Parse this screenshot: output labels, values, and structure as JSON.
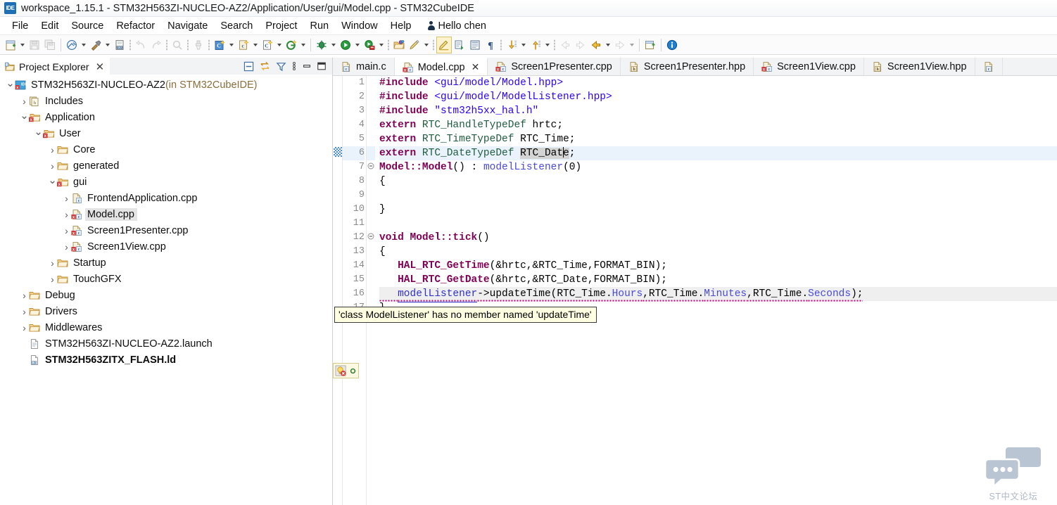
{
  "window": {
    "icon": "ide-icon",
    "title": "workspace_1.15.1 - STM32H563ZI-NUCLEO-AZ2/Application/User/gui/Model.cpp - STM32CubeIDE"
  },
  "menu": {
    "items": [
      "File",
      "Edit",
      "Source",
      "Refactor",
      "Navigate",
      "Search",
      "Project",
      "Run",
      "Window",
      "Help"
    ],
    "user": "Hello chen",
    "user_icon": "person-icon"
  },
  "toolbar": {
    "groups": [
      {
        "items": [
          {
            "name": "new-icon",
            "kind": "new",
            "dropdown": true
          },
          {
            "name": "save-icon",
            "kind": "save",
            "dropdown": false,
            "disabled": true
          },
          {
            "name": "save-all-icon",
            "kind": "saveall",
            "dropdown": false,
            "disabled": true
          }
        ]
      },
      {
        "items": [
          {
            "name": "build-all-icon",
            "kind": "buildall",
            "dropdown": true
          },
          {
            "name": "build-hammer-icon",
            "kind": "hammer",
            "dropdown": true
          },
          {
            "name": "build-binary-icon",
            "kind": "binary",
            "dropdown": false
          }
        ]
      },
      {
        "items": [
          {
            "name": "undo-icon",
            "kind": "undo",
            "dropdown": false,
            "disabled": true
          },
          {
            "name": "redo-icon",
            "kind": "redo",
            "dropdown": false,
            "disabled": true
          }
        ]
      },
      {
        "items": [
          {
            "name": "terminate-icon",
            "kind": "terminate",
            "dropdown": false,
            "disabled": true
          }
        ]
      },
      {
        "items": [
          {
            "name": "clean-icon",
            "kind": "clean",
            "dropdown": false,
            "disabled": true
          }
        ]
      },
      {
        "items": [
          {
            "name": "new-c-cpp-project-icon",
            "kind": "cproj",
            "dropdown": true
          },
          {
            "name": "new-c-file-icon",
            "kind": "cfile",
            "dropdown": true
          },
          {
            "name": "new-c-class-icon",
            "kind": "cclass",
            "dropdown": true
          },
          {
            "name": "git-icon",
            "kind": "git",
            "dropdown": true
          }
        ]
      },
      {
        "items": [
          {
            "name": "debug-icon",
            "kind": "debug",
            "dropdown": true
          },
          {
            "name": "run-icon",
            "kind": "run",
            "dropdown": true
          },
          {
            "name": "run-configuration-icon",
            "kind": "runcfg",
            "dropdown": true
          }
        ]
      },
      {
        "items": [
          {
            "name": "open-perspective-icon",
            "kind": "openpersp",
            "dropdown": false
          },
          {
            "name": "highlight-pencil-icon",
            "kind": "pencil",
            "dropdown": true
          }
        ]
      },
      {
        "items": [
          {
            "name": "toggle-mark-occurrences-icon",
            "kind": "markocc",
            "dropdown": false,
            "pressed": true
          },
          {
            "name": "show-whitespace-icon",
            "kind": "whitespace",
            "dropdown": false
          },
          {
            "name": "show-source-quick-icon",
            "kind": "srcquick",
            "dropdown": false
          },
          {
            "name": "pilcrow-icon",
            "kind": "pilcrow",
            "dropdown": false
          }
        ]
      },
      {
        "items": [
          {
            "name": "next-annotation-icon",
            "kind": "nextannot",
            "dropdown": true
          },
          {
            "name": "previous-annotation-icon",
            "kind": "prevannot",
            "dropdown": true
          }
        ]
      },
      {
        "items": [
          {
            "name": "back-disabled-icon",
            "kind": "backdis",
            "dropdown": false,
            "disabled": true
          },
          {
            "name": "forward-disabled-icon",
            "kind": "fwddis",
            "dropdown": false,
            "disabled": true
          },
          {
            "name": "back-icon",
            "kind": "back",
            "dropdown": true
          },
          {
            "name": "forward-icon",
            "kind": "forward",
            "dropdown": true,
            "disabled": true
          }
        ]
      },
      {
        "items": [
          {
            "name": "new-window-icon",
            "kind": "newwin",
            "dropdown": false
          }
        ]
      },
      {
        "items": [
          {
            "name": "info-icon",
            "kind": "info",
            "dropdown": false
          }
        ]
      }
    ]
  },
  "explorer": {
    "title": "Project Explorer",
    "close_label": "✕",
    "tools": [
      {
        "name": "collapse-all-icon",
        "label": "collapse-all"
      },
      {
        "name": "link-with-editor-icon",
        "label": "link-with-editor"
      },
      {
        "name": "filter-icon",
        "label": "filters"
      },
      {
        "name": "view-menu-icon",
        "label": "view-menu"
      },
      {
        "name": "minimize-icon",
        "label": "minimize"
      },
      {
        "name": "maximize-icon",
        "label": "maximize"
      }
    ],
    "tree": [
      {
        "indent": 0,
        "twist": "v",
        "icon": "project-icon",
        "label": "STM32H563ZI-NUCLEO-AZ2",
        "suffix": " (in STM32CubeIDE)",
        "bold": false,
        "selected": false
      },
      {
        "indent": 1,
        "twist": ">",
        "icon": "includes-icon",
        "label": "Includes",
        "suffix": "",
        "bold": false,
        "selected": false
      },
      {
        "indent": 1,
        "twist": "v",
        "icon": "src-folder-error-icon",
        "label": "Application",
        "suffix": "",
        "bold": false,
        "selected": false
      },
      {
        "indent": 2,
        "twist": "v",
        "icon": "src-folder-error-icon",
        "label": "User",
        "suffix": "",
        "bold": false,
        "selected": false
      },
      {
        "indent": 3,
        "twist": ">",
        "icon": "folder-icon",
        "label": "Core",
        "suffix": "",
        "bold": false,
        "selected": false
      },
      {
        "indent": 3,
        "twist": ">",
        "icon": "folder-icon",
        "label": "generated",
        "suffix": "",
        "bold": false,
        "selected": false
      },
      {
        "indent": 3,
        "twist": "v",
        "icon": "src-folder-error-icon",
        "label": "gui",
        "suffix": "",
        "bold": false,
        "selected": false
      },
      {
        "indent": 4,
        "twist": ">",
        "icon": "cpp-file-icon",
        "label": "FrontendApplication.cpp",
        "suffix": "",
        "bold": false,
        "selected": false
      },
      {
        "indent": 4,
        "twist": ">",
        "icon": "cpp-file-error-icon",
        "label": "Model.cpp",
        "suffix": "",
        "bold": false,
        "selected": true
      },
      {
        "indent": 4,
        "twist": ">",
        "icon": "cpp-file-error-icon",
        "label": "Screen1Presenter.cpp",
        "suffix": "",
        "bold": false,
        "selected": false
      },
      {
        "indent": 4,
        "twist": ">",
        "icon": "cpp-file-error-icon",
        "label": "Screen1View.cpp",
        "suffix": "",
        "bold": false,
        "selected": false
      },
      {
        "indent": 3,
        "twist": ">",
        "icon": "folder-icon",
        "label": "Startup",
        "suffix": "",
        "bold": false,
        "selected": false
      },
      {
        "indent": 3,
        "twist": ">",
        "icon": "folder-icon",
        "label": "TouchGFX",
        "suffix": "",
        "bold": false,
        "selected": false
      },
      {
        "indent": 1,
        "twist": ">",
        "icon": "folder-icon",
        "label": "Debug",
        "suffix": "",
        "bold": false,
        "selected": false
      },
      {
        "indent": 1,
        "twist": ">",
        "icon": "folder-icon",
        "label": "Drivers",
        "suffix": "",
        "bold": false,
        "selected": false
      },
      {
        "indent": 1,
        "twist": ">",
        "icon": "folder-icon",
        "label": "Middlewares",
        "suffix": "",
        "bold": false,
        "selected": false
      },
      {
        "indent": 1,
        "twist": "",
        "icon": "launch-file-icon",
        "label": "STM32H563ZI-NUCLEO-AZ2.launch",
        "suffix": "",
        "bold": false,
        "selected": false
      },
      {
        "indent": 1,
        "twist": "",
        "icon": "ld-file-icon",
        "label": "STM32H563ZITX_FLASH.ld",
        "suffix": "",
        "bold": true,
        "selected": false
      }
    ]
  },
  "editor": {
    "tabs": [
      {
        "label": "main.c",
        "icon": "c-file-icon",
        "active": false,
        "closable": false
      },
      {
        "label": "Model.cpp",
        "icon": "cpp-file-error-icon",
        "active": true,
        "closable": true
      },
      {
        "label": "Screen1Presenter.cpp",
        "icon": "cpp-file-error-icon",
        "active": false,
        "closable": false
      },
      {
        "label": "Screen1Presenter.hpp",
        "icon": "hpp-file-icon",
        "active": false,
        "closable": false
      },
      {
        "label": "Screen1View.cpp",
        "icon": "cpp-file-error-icon",
        "active": false,
        "closable": false
      },
      {
        "label": "Screen1View.hpp",
        "icon": "hpp-file-icon",
        "active": false,
        "closable": false
      },
      {
        "label": "",
        "icon": "c-file-icon",
        "active": false,
        "closable": false
      }
    ],
    "close_glyph": "✕",
    "line_numbers": [
      "1",
      "2",
      "3",
      "4",
      "5",
      "6",
      "7",
      "8",
      "9",
      "10",
      "11",
      "12",
      "13",
      "14",
      "15",
      "16",
      "17"
    ],
    "lines": [
      {
        "n": "1",
        "fold": "",
        "highlight": false,
        "tokens": [
          {
            "t": "#include",
            "c": "kw"
          },
          {
            "t": " ",
            "c": "plain"
          },
          {
            "t": "<gui/model/Model.hpp>",
            "c": "inc-path"
          }
        ]
      },
      {
        "n": "2",
        "fold": "",
        "highlight": false,
        "tokens": [
          {
            "t": "#include",
            "c": "kw"
          },
          {
            "t": " ",
            "c": "plain"
          },
          {
            "t": "<gui/model/ModelListener.hpp>",
            "c": "inc-path"
          }
        ]
      },
      {
        "n": "3",
        "fold": "",
        "highlight": false,
        "tokens": [
          {
            "t": "#include",
            "c": "kw"
          },
          {
            "t": " ",
            "c": "plain"
          },
          {
            "t": "\"stm32h5xx_hal.h\"",
            "c": "str"
          }
        ]
      },
      {
        "n": "4",
        "fold": "",
        "highlight": false,
        "tokens": [
          {
            "t": "extern",
            "c": "kw"
          },
          {
            "t": " ",
            "c": "plain"
          },
          {
            "t": "RTC_HandleTypeDef",
            "c": "type"
          },
          {
            "t": " hrtc;",
            "c": "plain"
          }
        ]
      },
      {
        "n": "5",
        "fold": "",
        "highlight": false,
        "tokens": [
          {
            "t": "extern",
            "c": "kw"
          },
          {
            "t": " ",
            "c": "plain"
          },
          {
            "t": "RTC_TimeTypeDef",
            "c": "type"
          },
          {
            "t": " RTC_Time;",
            "c": "plain"
          }
        ]
      },
      {
        "n": "6",
        "fold": "",
        "highlight": true,
        "tokens": [
          {
            "t": "extern",
            "c": "kw"
          },
          {
            "t": " ",
            "c": "plain"
          },
          {
            "t": "RTC_DateTypeDef",
            "c": "type"
          },
          {
            "t": " ",
            "c": "plain"
          },
          {
            "t": "RTC_Date",
            "c": "sel-token"
          },
          {
            "t": ";",
            "c": "plain"
          }
        ]
      },
      {
        "n": "7",
        "fold": "-",
        "highlight": false,
        "tokens": [
          {
            "t": "Model::Model",
            "c": "func"
          },
          {
            "t": "() : ",
            "c": "plain"
          },
          {
            "t": "modelListener",
            "c": "field"
          },
          {
            "t": "(0)",
            "c": "plain"
          }
        ]
      },
      {
        "n": "8",
        "fold": "",
        "highlight": false,
        "tokens": [
          {
            "t": "{",
            "c": "plain"
          }
        ]
      },
      {
        "n": "9",
        "fold": "",
        "highlight": false,
        "tokens": []
      },
      {
        "n": "10",
        "fold": "",
        "highlight": false,
        "tokens": [
          {
            "t": "}",
            "c": "plain"
          }
        ]
      },
      {
        "n": "11",
        "fold": "",
        "highlight": false,
        "tokens": []
      },
      {
        "n": "12",
        "fold": "-",
        "highlight": false,
        "tokens": [
          {
            "t": "void",
            "c": "kw"
          },
          {
            "t": " ",
            "c": "plain"
          },
          {
            "t": "Model::tick",
            "c": "func"
          },
          {
            "t": "()",
            "c": "plain"
          }
        ]
      },
      {
        "n": "13",
        "fold": "",
        "highlight": false,
        "tokens": [
          {
            "t": "{",
            "c": "plain"
          }
        ]
      },
      {
        "n": "14",
        "fold": "",
        "highlight": false,
        "tokens": [
          {
            "t": "   ",
            "c": "plain"
          },
          {
            "t": "HAL_RTC_GetTime",
            "c": "func"
          },
          {
            "t": "(&hrtc,&RTC_Time,FORMAT_BIN);",
            "c": "plain"
          }
        ]
      },
      {
        "n": "15",
        "fold": "",
        "highlight": false,
        "tokens": [
          {
            "t": "   ",
            "c": "plain"
          },
          {
            "t": "HAL_RTC_GetDate",
            "c": "func"
          },
          {
            "t": "(&hrtc,&RTC_Date,FORMAT_BIN);",
            "c": "plain"
          }
        ]
      },
      {
        "n": "16",
        "fold": "",
        "highlight": false,
        "error": true,
        "tokens": [
          {
            "t": "   ",
            "c": "plain"
          },
          {
            "t": "modelListener",
            "c": "fieldlink"
          },
          {
            "t": "->updateTime(RTC_Time.",
            "c": "plain"
          },
          {
            "t": "Hours",
            "c": "field"
          },
          {
            "t": ",RTC_Time.",
            "c": "plain"
          },
          {
            "t": "Minutes",
            "c": "field"
          },
          {
            "t": ",RTC_Time.",
            "c": "plain"
          },
          {
            "t": "Seconds",
            "c": "field"
          },
          {
            "t": ");",
            "c": "plain"
          }
        ]
      },
      {
        "n": "17",
        "fold": "",
        "highlight": false,
        "tokens": [
          {
            "t": "}",
            "c": "plain"
          }
        ]
      }
    ],
    "error_tooltip": "'class ModelListener' has no member named 'updateTime'",
    "quickfix_icons": [
      "quickfix-bulb-error-icon",
      "breakpoint-dot-icon"
    ],
    "overview_marker": "occurrence-marker"
  },
  "watermark": {
    "text": "ST中文论坛",
    "icon": "chat-bubbles-icon",
    "color": "#b7c2d2"
  },
  "colors": {
    "keyword": "#7f0055",
    "string": "#2a00ff",
    "type": "#1f5c3f",
    "field": "#4a4ad8",
    "error_squiggle": "#c0007a",
    "highlight_line": "#eaf2fb",
    "tooltip_bg": "#ffffe1"
  }
}
